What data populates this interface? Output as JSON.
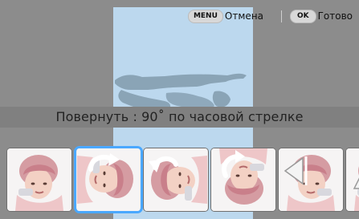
{
  "topbar": {
    "menu_key": "MENU",
    "cancel_label": "Отмена",
    "ok_key": "OK",
    "done_label": "Готово"
  },
  "status": {
    "message": "Повернуть : 90˚ по часовой стрелке"
  },
  "filmstrip": {
    "thumbnails": [
      {
        "name": "thumb-original",
        "icon": "none",
        "selected": false
      },
      {
        "name": "thumb-rotate-right-90",
        "icon": "rotate-cw-icon",
        "selected": true
      },
      {
        "name": "thumb-rotate-left-90",
        "icon": "rotate-ccw-icon",
        "selected": false
      },
      {
        "name": "thumb-rotate-180",
        "icon": "rotate-180-icon",
        "selected": false
      },
      {
        "name": "thumb-flip-horizontal",
        "icon": "flip-horizontal-icon",
        "selected": false
      },
      {
        "name": "thumb-flip-vertical",
        "icon": "flip-vertical-icon",
        "selected": false
      }
    ]
  },
  "colors": {
    "background": "#8c8c8c",
    "preview": "#bcd8ee",
    "selected": "#4aa8ff",
    "silhouette": "#8aa4b6"
  }
}
